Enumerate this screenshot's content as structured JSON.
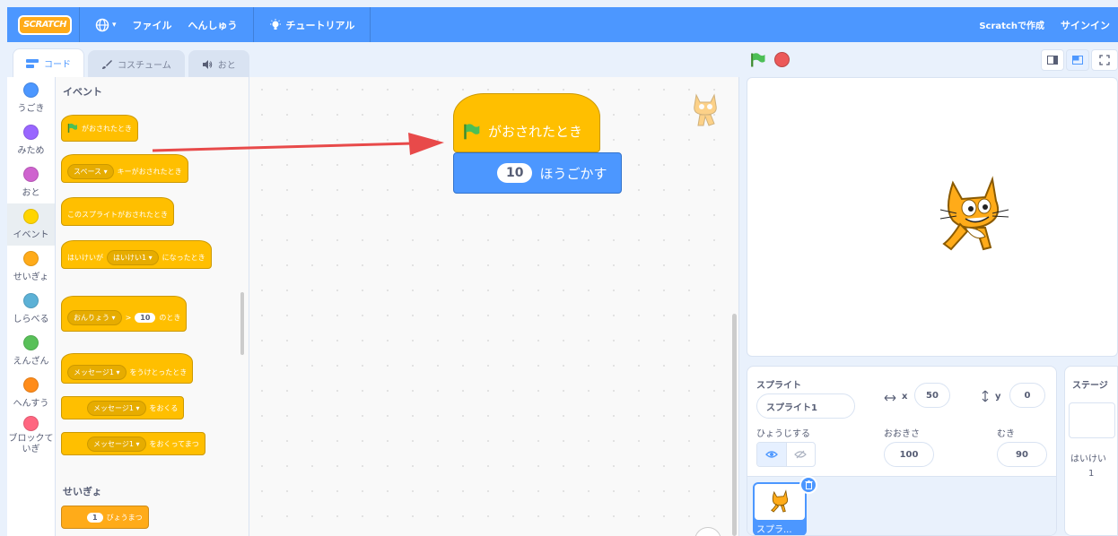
{
  "menubar": {
    "logo": "SCRATCH",
    "lang_caret": "▾",
    "file": "ファイル",
    "edit": "へんしゅう",
    "tutorials": "チュートリアル",
    "create": "Scratchで作成",
    "signin": "サインイン"
  },
  "tabs": {
    "code": "コード",
    "costumes": "コスチューム",
    "sounds": "おと"
  },
  "categories": [
    {
      "label": "うごき",
      "color": "#4c97ff"
    },
    {
      "label": "みため",
      "color": "#9966ff"
    },
    {
      "label": "おと",
      "color": "#cf63cf"
    },
    {
      "label": "イベント",
      "color": "#ffd500"
    },
    {
      "label": "せいぎょ",
      "color": "#ffab19"
    },
    {
      "label": "しらべる",
      "color": "#5cb1d6"
    },
    {
      "label": "えんざん",
      "color": "#59c059"
    },
    {
      "label": "へんすう",
      "color": "#ff8c1a"
    },
    {
      "label": "ブロックて\nいぎ",
      "color": "#ff6680"
    }
  ],
  "palette": {
    "events_heading": "イベント",
    "flag_clicked": "がおされたとき",
    "key_dropdown": "スペース ▾",
    "key_pressed": "キーがおされたとき",
    "sprite_clicked": "このスプライトがおされたとき",
    "backdrop_prefix": "はいけいが",
    "backdrop_dropdown": "はいけい1 ▾",
    "backdrop_suffix": "になったとき",
    "loudness_dropdown": "おんりょう ▾",
    "gt": ">",
    "loudness_value": "10",
    "loudness_suffix": "のとき",
    "receive_dropdown": "メッセージ1 ▾",
    "receive_suffix": "をうけとったとき",
    "broadcast_dropdown": "メッセージ1 ▾",
    "broadcast_suffix": "をおくる",
    "broadcast_wait_dropdown": "メッセージ1 ▾",
    "broadcast_wait_suffix": "をおくってまつ",
    "control_heading": "せいぎょ",
    "wait_value": "1",
    "wait_suffix": "びょうまつ"
  },
  "script": {
    "hat_label": "がおされたとき",
    "move_value": "10",
    "move_label": "ほうごかす"
  },
  "sprite_info": {
    "sprite_label": "スプライト",
    "sprite_name": "スプライト1",
    "x_label": "x",
    "x_value": "50",
    "y_label": "y",
    "y_value": "0",
    "show_label": "ひょうじする",
    "size_label": "おおきさ",
    "size_value": "100",
    "direction_label": "むき",
    "direction_value": "90",
    "tile_name": "スプラ..."
  },
  "stage_pane": {
    "title": "ステージ",
    "backdrops_label": "はいけい",
    "backdrops_count": "1"
  },
  "colors": {
    "menubar": "#4c97ff",
    "events": "#ffbf00",
    "motion": "#4c97ff",
    "control": "#ffab19",
    "arrow": "#e84a4a"
  }
}
